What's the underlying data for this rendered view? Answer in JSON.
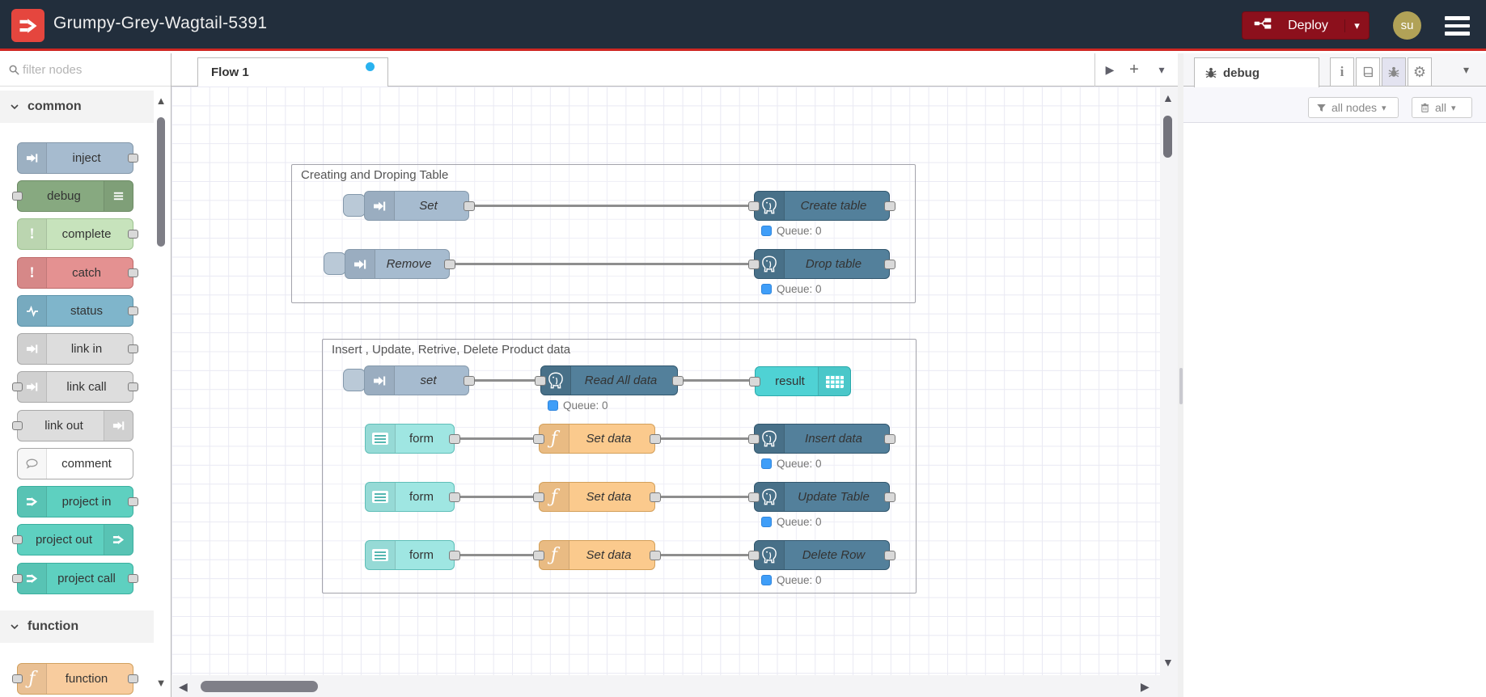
{
  "header": {
    "title": "Grumpy-Grey-Wagtail-5391",
    "deploy_label": "Deploy",
    "user_initials": "su"
  },
  "palette": {
    "filter_placeholder": "filter nodes",
    "categories": [
      {
        "label": "common",
        "items": [
          {
            "label": "inject"
          },
          {
            "label": "debug"
          },
          {
            "label": "complete"
          },
          {
            "label": "catch"
          },
          {
            "label": "status"
          },
          {
            "label": "link in"
          },
          {
            "label": "link call"
          },
          {
            "label": "link out"
          },
          {
            "label": "comment"
          },
          {
            "label": "project in"
          },
          {
            "label": "project out"
          },
          {
            "label": "project call"
          }
        ]
      },
      {
        "label": "function",
        "items": [
          {
            "label": "function"
          }
        ]
      }
    ]
  },
  "workspace": {
    "tab_label": "Flow 1"
  },
  "canvas": {
    "status_label": "Queue: 0",
    "groups": [
      {
        "label": "Creating and Droping Table",
        "nodes": [
          {
            "label": "Set"
          },
          {
            "label": "Create table"
          },
          {
            "label": "Remove"
          },
          {
            "label": "Drop table"
          }
        ]
      },
      {
        "label": "Insert , Update, Retrive, Delete Product data",
        "nodes": [
          {
            "label": "set"
          },
          {
            "label": "Read All data"
          },
          {
            "label": "result"
          },
          {
            "label": "form"
          },
          {
            "label": "Set data"
          },
          {
            "label": "Insert data"
          },
          {
            "label": "form"
          },
          {
            "label": "Set data"
          },
          {
            "label": "Update Table"
          },
          {
            "label": "form"
          },
          {
            "label": "Set data"
          },
          {
            "label": "Delete Row"
          }
        ]
      }
    ]
  },
  "sidebar": {
    "tab_label": "debug",
    "filter_label": "all nodes",
    "clear_label": "all"
  },
  "colors": {
    "header_bg": "#222e3c",
    "accent_red": "#cf2722",
    "deploy_bg": "#8C101C",
    "avatar_bg": "#b1a257",
    "flow_dirty_dot": "#29b2ef",
    "status_dot": "#3f9ef8",
    "inject": "#a6bbcf",
    "debug": "#87a980",
    "complete": "#c7e3bc",
    "catch": "#e49191",
    "status": "#7fb5cb",
    "link": "#dddddd",
    "project": "#5ed0c0",
    "function": "#f8cc9e",
    "postgres": "#53809b",
    "form": "#9fe6e2",
    "result": "#4fd2d4"
  }
}
